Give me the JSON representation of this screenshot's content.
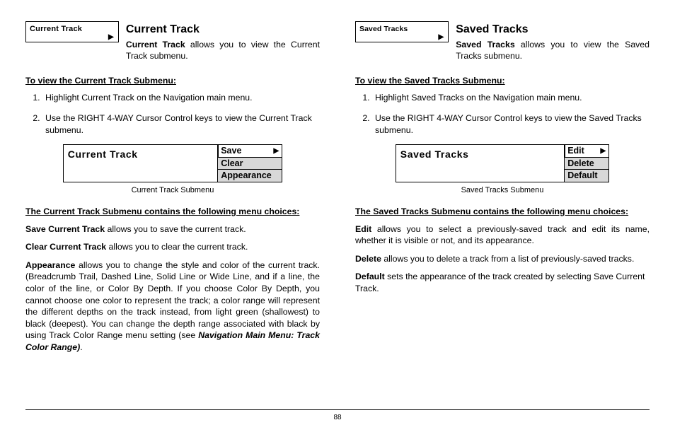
{
  "left": {
    "uibox_label": "Current Track",
    "title": "Current Track",
    "intro_bold": "Current Track",
    "intro_rest": " allows you to view the Current Track submenu.",
    "howto_h": "To view the Current Track Submenu:",
    "step1": "Highlight Current Track on the Navigation main menu.",
    "step2": "Use the RIGHT 4-WAY Cursor Control keys to view the Current Track submenu.",
    "submenu_main": "Current Track",
    "opt1": "Save",
    "opt2": "Clear",
    "opt3": "Appearance",
    "caption": "Current Track Submenu",
    "contains_h": "The Current Track Submenu contains the following menu choices:",
    "p_save_b": "Save Current Track",
    "p_save_r": " allows you to save the current track.",
    "p_clear_b": "Clear Current Track",
    "p_clear_r": " allows you to clear the current track.",
    "p_app_b": "Appearance",
    "p_app_r": " allows you to change the style and color of the current track. (Breadcrumb Trail, Dashed Line, Solid Line or Wide Line, and if a line, the color of the line, or Color By Depth. If you choose Color By Depth, you cannot choose one color to represent the track; a color range will represent the different depths on the track instead, from light green (shallowest) to black (deepest). You can change the depth range associated with black by using Track Color Range menu setting (see ",
    "p_app_i": "Navigation Main Menu: Track Color Range)",
    "p_app_end": "."
  },
  "right": {
    "uibox_label": "Saved Tracks",
    "title": "Saved Tracks",
    "intro_bold": "Saved Tracks",
    "intro_rest": " allows you to view the Saved Tracks submenu.",
    "howto_h": "To view the Saved Tracks Submenu:",
    "step1": "Highlight Saved Tracks on the Navigation main menu.",
    "step2": "Use the RIGHT 4-WAY Cursor Control keys to view the Saved Tracks submenu.",
    "submenu_main": "Saved Tracks",
    "opt1": "Edit",
    "opt2": "Delete",
    "opt3": "Default",
    "caption": "Saved Tracks Submenu",
    "contains_h": "The Saved Tracks Submenu contains the following menu choices:",
    "p_edit_b": "Edit",
    "p_edit_r": " allows you to select a previously-saved track and edit its name, whether it is visible or not, and its appearance.",
    "p_del_b": "Delete",
    "p_del_r": " allows you to delete a track from a list of previously-saved tracks.",
    "p_def_b": "Default",
    "p_def_r": " sets the appearance of the track created by selecting Save Current Track."
  },
  "page_num": "88"
}
